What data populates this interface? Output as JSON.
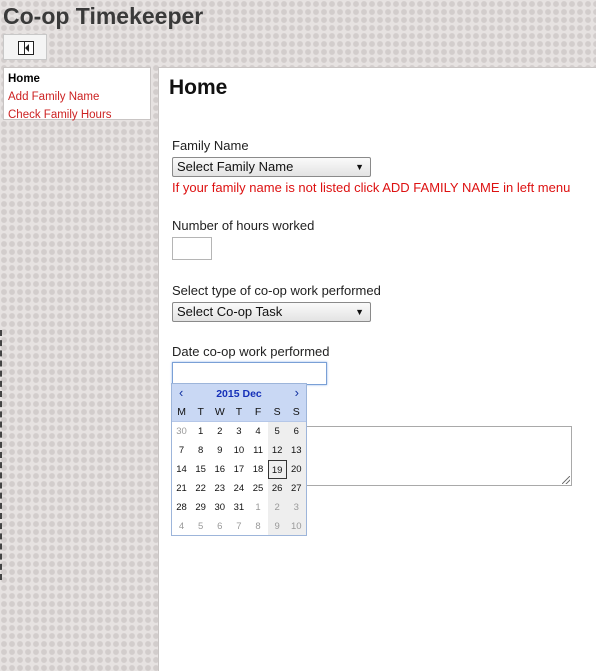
{
  "app_title": "Co-op Timekeeper",
  "sidebar": {
    "items": [
      {
        "label": "Home",
        "active": true
      },
      {
        "label": "Add Family Name",
        "active": false
      },
      {
        "label": "Check Family Hours",
        "active": false
      }
    ]
  },
  "main": {
    "title": "Home",
    "family_label": "Family Name",
    "family_select": "Select Family Name",
    "family_hint": "If your family name is not listed click ADD FAMILY NAME in left menu",
    "hours_label": "Number of hours worked",
    "hours_value": "",
    "task_label": "Select type of co-op work performed",
    "task_select": "Select Co-op Task",
    "date_label": "Date co-op work performed",
    "date_value": ""
  },
  "calendar": {
    "prev": "‹",
    "next": "›",
    "month_label": "2015 Dec",
    "weekdays": [
      "M",
      "T",
      "W",
      "T",
      "F",
      "S",
      "S"
    ],
    "weeks": [
      [
        "30",
        "1",
        "2",
        "3",
        "4",
        "5",
        "6"
      ],
      [
        "7",
        "8",
        "9",
        "10",
        "11",
        "12",
        "13"
      ],
      [
        "14",
        "15",
        "16",
        "17",
        "18",
        "19",
        "20"
      ],
      [
        "21",
        "22",
        "23",
        "24",
        "25",
        "26",
        "27"
      ],
      [
        "28",
        "29",
        "30",
        "31",
        "1",
        "2",
        "3"
      ],
      [
        "4",
        "5",
        "6",
        "7",
        "8",
        "9",
        "10"
      ]
    ],
    "other_month": [
      [
        0
      ],
      [],
      [],
      [],
      [
        4,
        5,
        6
      ],
      [
        0,
        1,
        2,
        3,
        4,
        5,
        6
      ]
    ],
    "today": [
      2,
      5
    ]
  },
  "colors": {
    "accent": "#cc2222",
    "calendar_header": "#c9d8f4"
  }
}
